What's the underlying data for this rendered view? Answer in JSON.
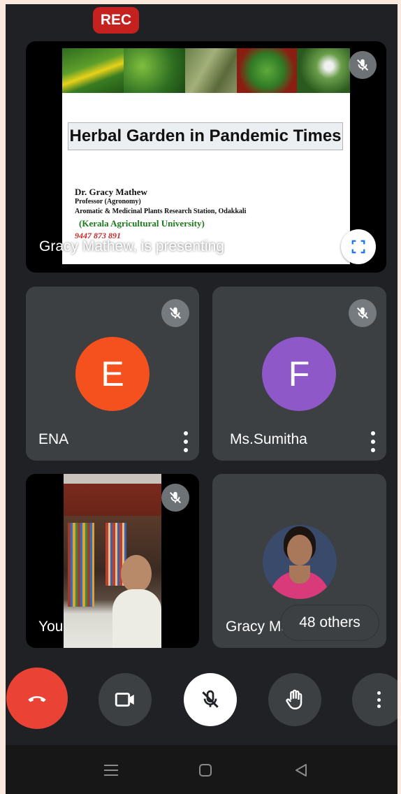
{
  "status": {
    "rec_label": "REC"
  },
  "presentation": {
    "slide_title": "Herbal Garden in Pandemic Times",
    "presenter_name": "Dr. Gracy Mathew",
    "presenter_role": "Professor (Agronomy)",
    "presenter_station": "Aromatic & Medicinal Plants Research Station, Odakkali",
    "university": "(Kerala Agricultural University)",
    "phone": "9447 873 891",
    "presenting_label": "Gracy Mathew, is presenting"
  },
  "participants": [
    {
      "name": "ENA",
      "initial": "E",
      "color": "#f4511e"
    },
    {
      "name": "Ms.Sumitha",
      "initial": "F",
      "color": "#8e58c9"
    },
    {
      "name": "You"
    },
    {
      "name": "Gracy Mathew"
    }
  ],
  "others_label": "48 others",
  "colors": {
    "end_call": "#ea4335",
    "tile_bg": "#3c4043",
    "background": "#202124"
  }
}
